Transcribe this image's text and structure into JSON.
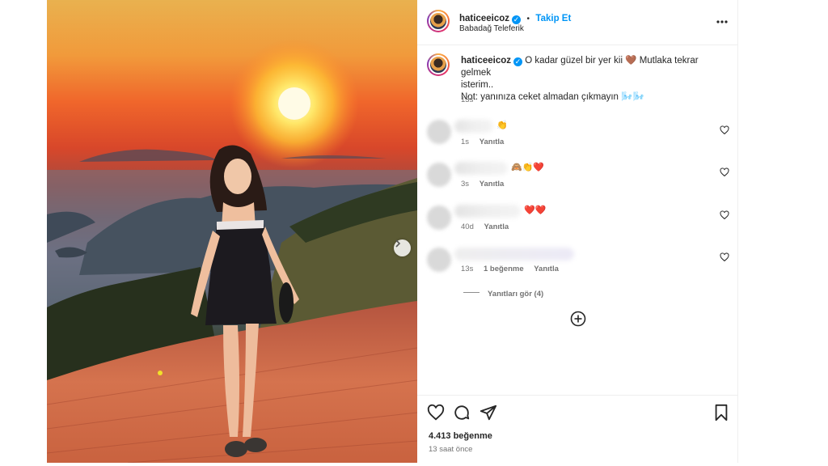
{
  "post": {
    "username": "haticeeicoz",
    "verified_icon": "verified-badge-icon",
    "follow_label": "Takip Et",
    "separator": "•",
    "location": "Babadağ Teleferik",
    "more_icon": "more-options-icon",
    "more_label": "..."
  },
  "caption": {
    "username": "haticeeicoz",
    "text_line1": "O kadar güzel bir yer kii 🤎 Mutlaka tekrar gelmek",
    "text_line2": "isterim..",
    "text_line3": "Not: yanınıza ceket almadan çıkmayın 🌬️🌬️",
    "time": "13s"
  },
  "comments": [
    {
      "emojis": "👏",
      "time": "1s",
      "reply_label": "Yanıtla",
      "likes_label": ""
    },
    {
      "emojis": "🙈👏❤️",
      "time": "3s",
      "reply_label": "Yanıtla",
      "likes_label": ""
    },
    {
      "emojis": "❤️❤️",
      "time": "40d",
      "reply_label": "Yanıtla",
      "likes_label": ""
    },
    {
      "emojis": "",
      "time": "13s",
      "reply_label": "Yanıtla",
      "likes_label": "1 beğenme"
    }
  ],
  "view_replies_label": "Yanıtları gör (4)",
  "load_more_icon": "plus-circle-icon",
  "actions": {
    "like_icon": "heart-icon",
    "comment_icon": "comment-icon",
    "share_icon": "send-icon",
    "save_icon": "bookmark-icon",
    "likes_count": "4.413 beğenme",
    "posted_ago": "13 saat önce"
  },
  "carousel": {
    "next_icon": "chevron-right-icon"
  },
  "colors": {
    "accent": "#0095f6",
    "text": "#262626",
    "muted": "#737373",
    "like_red": "#ed4956"
  }
}
